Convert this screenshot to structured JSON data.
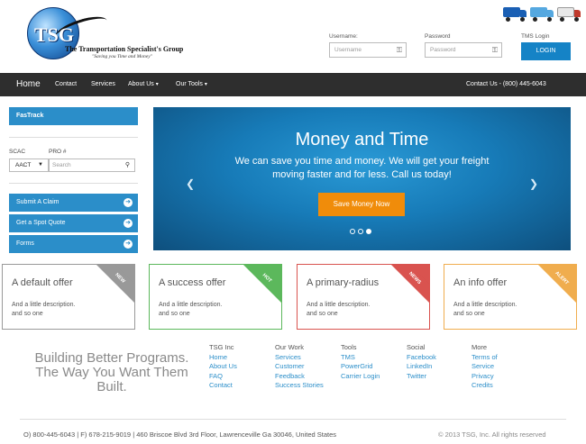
{
  "brand": {
    "logo_text": "TSG",
    "company_name": "The Transportation Specialist's Group",
    "tagline": "\"Saving you Time and Money\""
  },
  "header": {
    "trucks": [
      {
        "icon": "truck-blue-icon",
        "color": "#1a5fb4"
      },
      {
        "icon": "truck-lightblue-icon",
        "color": "#55a8e0"
      },
      {
        "icon": "truck-white-icon",
        "color": "#e8e8e8"
      }
    ],
    "username_label": "Username:",
    "username_placeholder": "Username",
    "password_label": "Password",
    "password_placeholder": "Password",
    "tms_label": "TMS Login",
    "login_button": "LOGIN"
  },
  "nav": {
    "home": "Home",
    "items": [
      "Contact",
      "Services",
      "About Us",
      "Our Tools"
    ],
    "contact_phone": "Contact Us - (800) 445-6043"
  },
  "sidebar": {
    "fastrack": "FasTrack",
    "scac_label": "SCAC",
    "pro_label": "PRO #",
    "scac_value": "AACT",
    "pro_placeholder": "Search",
    "links": [
      "Submit A Claim",
      "Get a Spot Quote",
      "Forms"
    ]
  },
  "carousel": {
    "title": "Money and Time",
    "subtitle": "We can save you time and money. We will get your freight moving faster and for less. Call us today!",
    "button": "Save Money Now",
    "slide_count": 3,
    "active_slide": 3
  },
  "offers": [
    {
      "title": "A default offer",
      "desc1": "And a little description.",
      "desc2": "and so one",
      "ribbon": "NEW",
      "color": "#999999"
    },
    {
      "title": "A success offer",
      "desc1": "And a little description.",
      "desc2": "and so one",
      "ribbon": "HOT",
      "color": "#5cb85c"
    },
    {
      "title": "A primary-radius",
      "desc1": "And a little description.",
      "desc2": "and so one",
      "ribbon": "NEWS",
      "color": "#d9534f"
    },
    {
      "title": "An info offer",
      "desc1": "And a little description.",
      "desc2": "and so one",
      "ribbon": "ALERT",
      "color": "#f0ad4e"
    }
  ],
  "footer": {
    "slogan": [
      "Building Better Programs.",
      "The Way You Want Them",
      "Built."
    ],
    "columns": [
      {
        "heading": "TSG Inc",
        "links": [
          "Home",
          "About Us",
          "FAQ",
          "Contact"
        ]
      },
      {
        "heading": "Our Work",
        "links": [
          "Services",
          "Customer",
          "Feedback",
          "Success Stories"
        ]
      },
      {
        "heading": "Tools",
        "links": [
          "TMS",
          "PowerGrid",
          "Carrier Login"
        ]
      },
      {
        "heading": "Social",
        "links": [
          "Facebook",
          "LinkedIn",
          "Twitter"
        ]
      },
      {
        "heading": "More",
        "links": [
          "Terms of",
          "Service",
          "Privacy",
          "Credits"
        ]
      }
    ],
    "contact_line": "O) 800-445-6043 | F) 678-215-9019 | 460 Briscoe Blvd 3rd Floor, Lawrenceville Ga 30046, United States",
    "copyright": "© 2013 TSG, Inc. All rights reserved"
  }
}
